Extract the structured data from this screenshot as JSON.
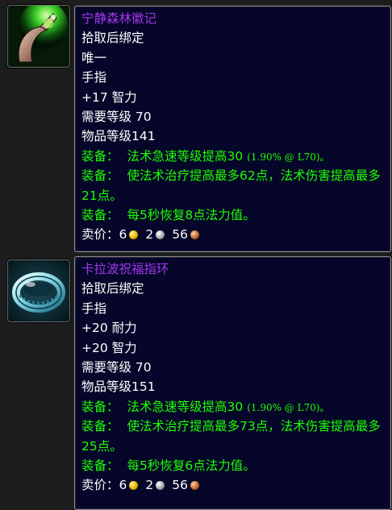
{
  "items": [
    {
      "icon": "green-jade-blade-ring-icon",
      "name": "宁静森林徽记",
      "bind": "拾取后绑定",
      "unique": "唯一",
      "slot": "手指",
      "stats": [
        "+17 智力"
      ],
      "req_level": "需要等级 70",
      "item_level": "物品等级141",
      "haste": {
        "label": "装备：",
        "text": "法术急速等级提高30",
        "note": "(1.90% @ L70)。"
      },
      "heal": {
        "label": "装备：",
        "text": "使法术治疗提高最多62点，法术伤害提高最多21点。"
      },
      "mana": {
        "label": "装备：",
        "text": "每5秒恢复8点法力值。"
      },
      "sell": {
        "label": "卖价：",
        "gold": "6",
        "silver": "2",
        "copper": "56"
      }
    },
    {
      "icon": "silver-blue-ring-icon",
      "name": "卡拉波祝福指环",
      "bind": "拾取后绑定",
      "slot": "手指",
      "stats": [
        "+20 耐力",
        "+20 智力"
      ],
      "req_level": "需要等级 70",
      "item_level": "物品等级151",
      "haste": {
        "label": "装备：",
        "text": "法术急速等级提高30",
        "note": "(1.90% @ L70)。"
      },
      "heal": {
        "label": "装备：",
        "text": "使法术治疗提高最多73点，法术伤害提高最多25点。"
      },
      "mana": {
        "label": "装备：",
        "text": "每5秒恢复6点法力值。"
      },
      "sell": {
        "label": "卖价：",
        "gold": "6",
        "silver": "2",
        "copper": "56"
      }
    }
  ],
  "colors": {
    "epic_name": "#a335ee",
    "equip_green": "#1eff00",
    "tooltip_bg": "#050629",
    "page_bg": "#1d1d1d"
  }
}
